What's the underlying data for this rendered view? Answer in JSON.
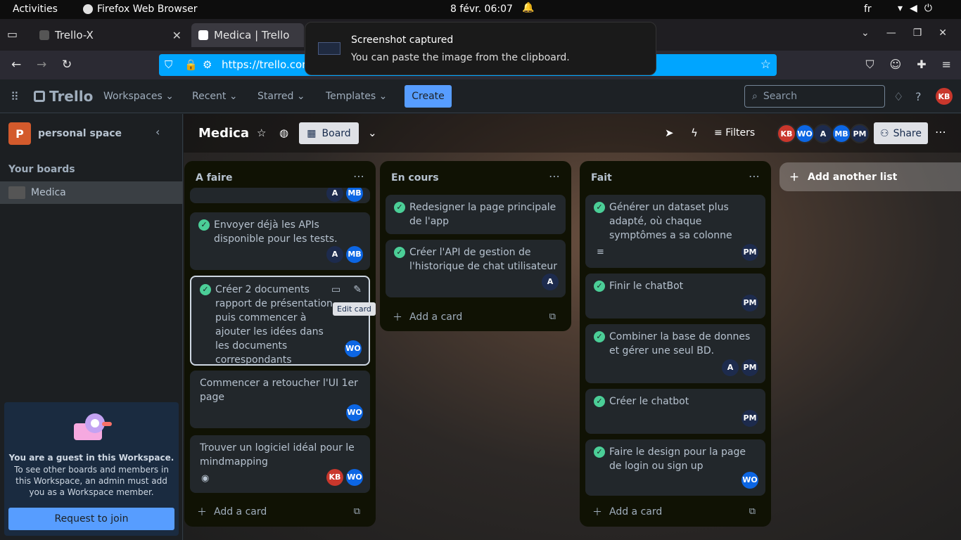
{
  "os": {
    "activities": "Activities",
    "app": "Firefox Web Browser",
    "clock": "8 févr.  06:07",
    "lang": "fr"
  },
  "browser": {
    "tabs": [
      {
        "title": "Trello-X"
      },
      {
        "title": "Medica | Trello"
      }
    ],
    "url": "https://trello.com"
  },
  "notification": {
    "title": "Screenshot captured",
    "body": "You can paste the image from the clipboard."
  },
  "header": {
    "logo": "Trello",
    "menus": [
      "Workspaces",
      "Recent",
      "Starred",
      "Templates"
    ],
    "create": "Create",
    "search_placeholder": "Search",
    "user": "KB"
  },
  "sidebar": {
    "workspace": "personal space",
    "workspace_initial": "P",
    "your_boards": "Your boards",
    "boards": [
      "Medica"
    ],
    "guest": {
      "title": "You are a guest in this Workspace.",
      "body": "To see other boards and members in this Workspace, an admin must add you as a Workspace member.",
      "button": "Request to join"
    }
  },
  "board": {
    "title": "Medica",
    "view": "Board",
    "filters": "Filters",
    "share": "Share",
    "members": [
      {
        "initials": "KB",
        "color": "#c9372c"
      },
      {
        "initials": "WO",
        "color": "#0c66e4"
      },
      {
        "initials": "A",
        "color": "#1d2b4d"
      },
      {
        "initials": "MB",
        "color": "#0c66e4"
      },
      {
        "initials": "PM",
        "color": "#1d2b4d"
      }
    ]
  },
  "lists": [
    {
      "title": "A faire",
      "add_card": "Add a card",
      "cards": [
        {
          "text": "Envoyer déjà les APIs disponible pour les tests.",
          "members": [
            "A",
            "MB"
          ],
          "done": true
        },
        {
          "text": "Créer 2 documents rapport de présentation puis commencer à ajouter les idées dans les documents correspondants",
          "members": [
            "WO"
          ],
          "done": true
        },
        {
          "text": "Commencer a retoucher l'UI 1er page",
          "members": [
            "WO"
          ],
          "done": false
        },
        {
          "text": "Trouver un logiciel idéal pour le mindmapping",
          "members": [
            "KB",
            "WO"
          ],
          "done": false
        }
      ]
    },
    {
      "title": "En cours",
      "add_card": "Add a card",
      "cards": [
        {
          "text": "Redesigner la page principale de l'app",
          "members": [],
          "done": true
        },
        {
          "text": "Créer l'API de gestion de l'historique de chat utilisateur",
          "members": [
            "A"
          ],
          "done": true
        }
      ]
    },
    {
      "title": "Fait",
      "add_card": "Add a card",
      "cards": [
        {
          "text": "Générer un dataset plus adapté, où chaque symptômes a sa colonne",
          "members": [
            "PM"
          ],
          "done": true
        },
        {
          "text": "Finir le chatBot",
          "members": [
            "PM"
          ],
          "done": true
        },
        {
          "text": "Combiner la base de donnes et gérer une seul BD.",
          "members": [
            "A",
            "PM"
          ],
          "done": true
        },
        {
          "text": "Créer le chatbot",
          "members": [
            "PM"
          ],
          "done": true
        },
        {
          "text": "Faire le design pour la page de login ou sign up",
          "members": [
            "WO"
          ],
          "done": true
        }
      ]
    }
  ],
  "add_list": "Add another list",
  "tooltip": "Edit card",
  "colors": {
    "accent": "#579dff",
    "done": "#4bce97"
  }
}
